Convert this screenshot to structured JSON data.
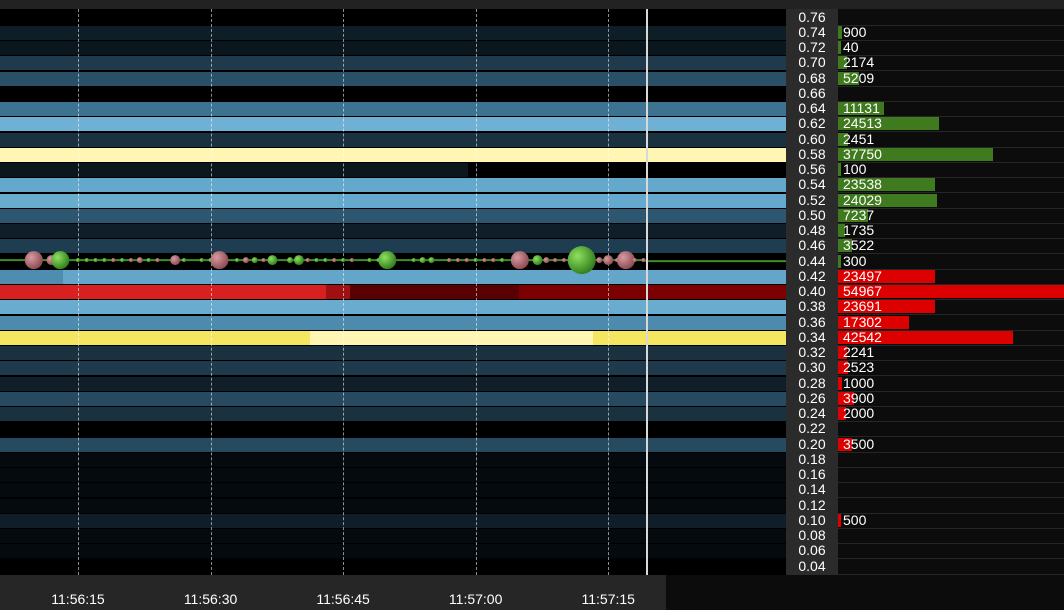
{
  "price_levels": [
    "0.76",
    "0.74",
    "0.72",
    "0.70",
    "0.68",
    "0.66",
    "0.64",
    "0.62",
    "0.60",
    "0.58",
    "0.56",
    "0.54",
    "0.52",
    "0.50",
    "0.48",
    "0.46",
    "0.44",
    "0.42",
    "0.40",
    "0.38",
    "0.36",
    "0.34",
    "0.32",
    "0.30",
    "0.28",
    "0.26",
    "0.24",
    "0.22",
    "0.20",
    "0.18",
    "0.16",
    "0.14",
    "0.12",
    "0.10",
    "0.08",
    "0.06",
    "0.04"
  ],
  "time_labels": [
    "11:56:15",
    "11:56:30",
    "11:56:45",
    "11:57:00",
    "11:57:15"
  ],
  "order_book": [
    {
      "price": "0.74",
      "size": "900",
      "side": "bid"
    },
    {
      "price": "0.72",
      "size": "40",
      "side": "bid"
    },
    {
      "price": "0.70",
      "size": "2174",
      "side": "bid"
    },
    {
      "price": "0.68",
      "size": "5209",
      "side": "bid"
    },
    {
      "price": "0.64",
      "size": "11131",
      "side": "bid"
    },
    {
      "price": "0.62",
      "size": "24513",
      "side": "bid"
    },
    {
      "price": "0.60",
      "size": "2451",
      "side": "bid"
    },
    {
      "price": "0.58",
      "size": "37750",
      "side": "bid"
    },
    {
      "price": "0.56",
      "size": "100",
      "side": "bid"
    },
    {
      "price": "0.54",
      "size": "23538",
      "side": "bid"
    },
    {
      "price": "0.52",
      "size": "24029",
      "side": "bid"
    },
    {
      "price": "0.50",
      "size": "7237",
      "side": "bid"
    },
    {
      "price": "0.48",
      "size": "1735",
      "side": "bid"
    },
    {
      "price": "0.46",
      "size": "3522",
      "side": "bid"
    },
    {
      "price": "0.44",
      "size": "300",
      "side": "bid"
    },
    {
      "price": "0.42",
      "size": "23497",
      "side": "ask"
    },
    {
      "price": "0.40",
      "size": "54967",
      "side": "ask"
    },
    {
      "price": "0.38",
      "size": "23691",
      "side": "ask"
    },
    {
      "price": "0.36",
      "size": "17302",
      "side": "ask"
    },
    {
      "price": "0.34",
      "size": "42542",
      "side": "ask"
    },
    {
      "price": "0.32",
      "size": "2241",
      "side": "ask"
    },
    {
      "price": "0.30",
      "size": "2523",
      "side": "ask"
    },
    {
      "price": "0.28",
      "size": "1000",
      "side": "ask"
    },
    {
      "price": "0.26",
      "size": "3900",
      "side": "ask"
    },
    {
      "price": "0.24",
      "size": "2000",
      "side": "ask"
    },
    {
      "price": "0.20",
      "size": "3500",
      "side": "ask"
    },
    {
      "price": "0.10",
      "size": "500",
      "side": "ask"
    }
  ],
  "heatmap_bands": [
    {
      "price": "0.74",
      "segments": [
        {
          "from": 0,
          "to": 1,
          "color": "#0e1e26"
        }
      ]
    },
    {
      "price": "0.72",
      "segments": [
        {
          "from": 0,
          "to": 1,
          "color": "#0b171e"
        }
      ]
    },
    {
      "price": "0.70",
      "segments": [
        {
          "from": 0,
          "to": 1,
          "color": "#1e3a4c"
        }
      ]
    },
    {
      "price": "0.68",
      "segments": [
        {
          "from": 0,
          "to": 1,
          "color": "#2a5068"
        }
      ]
    },
    {
      "price": "0.64",
      "segments": [
        {
          "from": 0,
          "to": 1,
          "color": "#3d7290"
        }
      ]
    },
    {
      "price": "0.62",
      "segments": [
        {
          "from": 0,
          "to": 1,
          "color": "#6eb1d4"
        }
      ]
    },
    {
      "price": "0.60",
      "segments": [
        {
          "from": 0,
          "to": 1,
          "color": "#1a3240"
        }
      ]
    },
    {
      "price": "0.58",
      "segments": [
        {
          "from": 0,
          "to": 1,
          "color": "#fff6b4"
        }
      ]
    },
    {
      "price": "0.56",
      "segments": [
        {
          "from": 0,
          "to": 0.595,
          "color": "#0c171d"
        },
        {
          "from": 0.595,
          "to": 1,
          "color": "#000000"
        }
      ]
    },
    {
      "price": "0.54",
      "segments": [
        {
          "from": 0,
          "to": 1,
          "color": "#64a8cc"
        }
      ]
    },
    {
      "price": "0.52",
      "segments": [
        {
          "from": 0,
          "to": 0.43,
          "color": "#6aaccc"
        },
        {
          "from": 0.43,
          "to": 1,
          "color": "#66a9cf"
        }
      ]
    },
    {
      "price": "0.50",
      "segments": [
        {
          "from": 0,
          "to": 1,
          "color": "#2d5670"
        }
      ]
    },
    {
      "price": "0.48",
      "segments": [
        {
          "from": 0,
          "to": 1,
          "color": "#0f1e28"
        }
      ]
    },
    {
      "price": "0.46",
      "segments": [
        {
          "from": 0,
          "to": 1,
          "color": "#1f3d50"
        }
      ]
    },
    {
      "price": "0.44",
      "segments": [
        {
          "from": 0,
          "to": 1,
          "color": "#000000"
        }
      ]
    },
    {
      "price": "0.42",
      "segments": [
        {
          "from": 0,
          "to": 0.08,
          "color": "#4e8cb0"
        },
        {
          "from": 0.08,
          "to": 1,
          "color": "#64a6ca"
        }
      ]
    },
    {
      "price": "0.40",
      "segments": [
        {
          "from": 0,
          "to": 0.415,
          "color": "#d82020"
        },
        {
          "from": 0.415,
          "to": 0.445,
          "color": "#a01010"
        },
        {
          "from": 0.445,
          "to": 0.66,
          "color": "#5a0000"
        },
        {
          "from": 0.66,
          "to": 1,
          "color": "#7c0000"
        }
      ]
    },
    {
      "price": "0.38",
      "segments": [
        {
          "from": 0,
          "to": 1,
          "color": "#6aaccf"
        }
      ]
    },
    {
      "price": "0.36",
      "segments": [
        {
          "from": 0,
          "to": 1,
          "color": "#4e8aae"
        }
      ]
    },
    {
      "price": "0.34",
      "segments": [
        {
          "from": 0,
          "to": 0.395,
          "color": "#f4e660"
        },
        {
          "from": 0.395,
          "to": 0.755,
          "color": "#fff6b4"
        },
        {
          "from": 0.755,
          "to": 1,
          "color": "#f4e660"
        }
      ]
    },
    {
      "price": "0.32",
      "segments": [
        {
          "from": 0,
          "to": 1,
          "color": "#1a3240"
        }
      ]
    },
    {
      "price": "0.30",
      "segments": [
        {
          "from": 0,
          "to": 1,
          "color": "#1e3a4c"
        }
      ]
    },
    {
      "price": "0.28",
      "segments": [
        {
          "from": 0,
          "to": 1,
          "color": "#0f1e28"
        }
      ]
    },
    {
      "price": "0.26",
      "segments": [
        {
          "from": 0,
          "to": 1,
          "color": "#264a60"
        }
      ]
    },
    {
      "price": "0.24",
      "segments": [
        {
          "from": 0,
          "to": 1,
          "color": "#1a3240"
        }
      ]
    },
    {
      "price": "0.20",
      "segments": [
        {
          "from": 0,
          "to": 1,
          "color": "#264a60"
        }
      ]
    },
    {
      "price": "0.18",
      "segments": [
        {
          "from": 0,
          "to": 1,
          "color": "#050a0e"
        }
      ]
    },
    {
      "price": "0.16",
      "segments": [
        {
          "from": 0,
          "to": 1,
          "color": "#050a0e"
        }
      ]
    },
    {
      "price": "0.14",
      "segments": [
        {
          "from": 0,
          "to": 1,
          "color": "#050a0e"
        }
      ]
    },
    {
      "price": "0.12",
      "segments": [
        {
          "from": 0,
          "to": 1,
          "color": "#050a0e"
        }
      ]
    },
    {
      "price": "0.10",
      "segments": [
        {
          "from": 0,
          "to": 1,
          "color": "#0f1e28"
        }
      ]
    },
    {
      "price": "0.08",
      "segments": [
        {
          "from": 0,
          "to": 1,
          "color": "#050a0e"
        }
      ]
    },
    {
      "price": "0.06",
      "segments": [
        {
          "from": 0,
          "to": 1,
          "color": "#050a0e"
        }
      ]
    }
  ],
  "trades": [
    {
      "time": "11:56:10",
      "side": "sell",
      "size": 9
    },
    {
      "time": "11:56:12",
      "side": "sell",
      "size": 5
    },
    {
      "time": "11:56:13",
      "side": "buy",
      "size": 9
    },
    {
      "time": "11:56:15",
      "side": "buy",
      "size": 2
    },
    {
      "time": "11:56:16",
      "side": "buy",
      "size": 2
    },
    {
      "time": "11:56:17",
      "side": "buy",
      "size": 2
    },
    {
      "time": "11:56:18",
      "side": "buy",
      "size": 2
    },
    {
      "time": "11:56:19",
      "side": "sell",
      "size": 2
    },
    {
      "time": "11:56:20",
      "side": "buy",
      "size": 2
    },
    {
      "time": "11:56:21",
      "side": "sell",
      "size": 2
    },
    {
      "time": "11:56:22",
      "side": "sell",
      "size": 3
    },
    {
      "time": "11:56:23",
      "side": "buy",
      "size": 2
    },
    {
      "time": "11:56:24",
      "side": "sell",
      "size": 2
    },
    {
      "time": "11:56:26",
      "side": "sell",
      "size": 5
    },
    {
      "time": "11:56:27",
      "side": "buy",
      "size": 2
    },
    {
      "time": "11:56:29",
      "side": "buy",
      "size": 2
    },
    {
      "time": "11:56:30",
      "side": "buy",
      "size": 2
    },
    {
      "time": "11:56:31",
      "side": "sell",
      "size": 9
    },
    {
      "time": "11:56:33",
      "side": "buy",
      "size": 2
    },
    {
      "time": "11:56:34",
      "side": "sell",
      "size": 3
    },
    {
      "time": "11:56:35",
      "side": "buy",
      "size": 3
    },
    {
      "time": "11:56:36",
      "side": "sell",
      "size": 2
    },
    {
      "time": "11:56:37",
      "side": "buy",
      "size": 5
    },
    {
      "time": "11:56:39",
      "side": "buy",
      "size": 3
    },
    {
      "time": "11:56:40",
      "side": "buy",
      "size": 5
    },
    {
      "time": "11:56:41",
      "side": "sell",
      "size": 2
    },
    {
      "time": "11:56:42",
      "side": "buy",
      "size": 2
    },
    {
      "time": "11:56:43",
      "side": "buy",
      "size": 2
    },
    {
      "time": "11:56:44",
      "side": "sell",
      "size": 2
    },
    {
      "time": "11:56:45",
      "side": "buy",
      "size": 2
    },
    {
      "time": "11:56:46",
      "side": "sell",
      "size": 2
    },
    {
      "time": "11:56:48",
      "side": "buy",
      "size": 2
    },
    {
      "time": "11:56:49",
      "side": "buy",
      "size": 2
    },
    {
      "time": "11:56:50",
      "side": "buy",
      "size": 9
    },
    {
      "time": "11:56:53",
      "side": "buy",
      "size": 2
    },
    {
      "time": "11:56:54",
      "side": "buy",
      "size": 3
    },
    {
      "time": "11:56:55",
      "side": "buy",
      "size": 3
    },
    {
      "time": "11:56:57",
      "side": "sell",
      "size": 2
    },
    {
      "time": "11:56:58",
      "side": "sell",
      "size": 2
    },
    {
      "time": "11:56:59",
      "side": "sell",
      "size": 2
    },
    {
      "time": "11:57:00",
      "side": "buy",
      "size": 2
    },
    {
      "time": "11:57:01",
      "side": "sell",
      "size": 2
    },
    {
      "time": "11:57:02",
      "side": "sell",
      "size": 2
    },
    {
      "time": "11:57:03",
      "side": "buy",
      "size": 2
    },
    {
      "time": "11:57:05",
      "side": "sell",
      "size": 9
    },
    {
      "time": "11:57:07",
      "side": "buy",
      "size": 5
    },
    {
      "time": "11:57:08",
      "side": "sell",
      "size": 3
    },
    {
      "time": "11:57:09",
      "side": "sell",
      "size": 2
    },
    {
      "time": "11:57:10",
      "side": "sell",
      "size": 2
    },
    {
      "time": "11:57:12",
      "side": "buy",
      "size": 14
    },
    {
      "time": "11:57:14",
      "side": "sell",
      "size": 3
    },
    {
      "time": "11:57:15",
      "side": "sell",
      "size": 5
    },
    {
      "time": "11:57:16",
      "side": "sell",
      "size": 2
    },
    {
      "time": "11:57:17",
      "side": "sell",
      "size": 9
    },
    {
      "time": "11:57:18",
      "side": "sell",
      "size": 2
    },
    {
      "time": "11:57:19",
      "side": "sell",
      "size": 2
    }
  ],
  "last_price_line": {
    "price": "0.44",
    "from_time": "11:57:19"
  },
  "colors": {
    "bid_bar": "#3f7a1f",
    "ask_bar": "#dd0000",
    "buy_bubble": "#4fae2e",
    "sell_bubble": "#b36f74"
  }
}
